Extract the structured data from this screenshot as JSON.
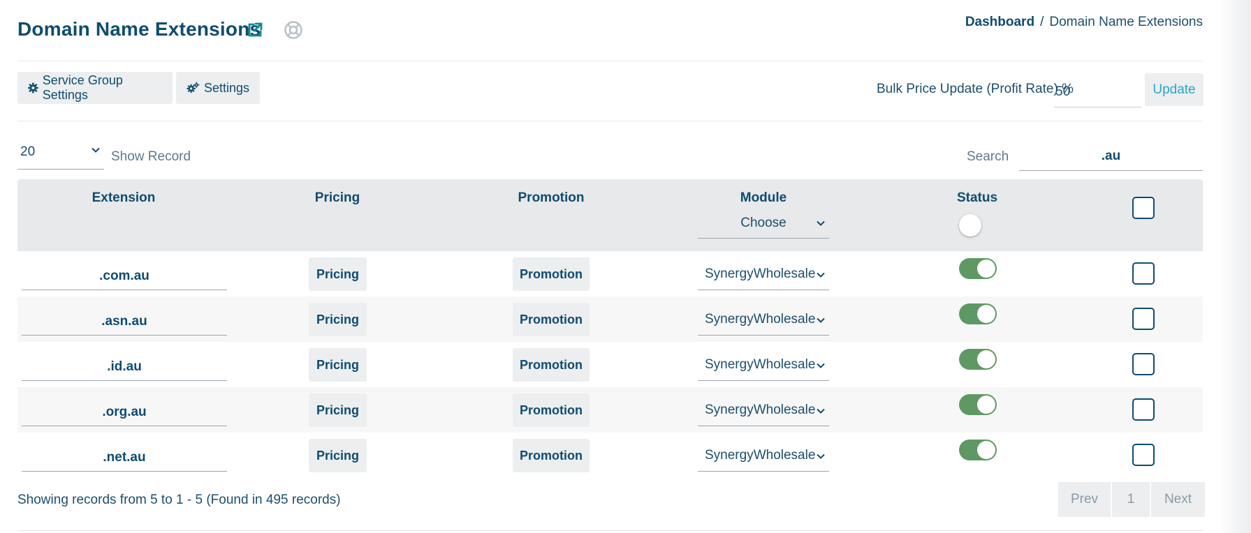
{
  "header": {
    "title": "Domain Name Extensions",
    "external_link_icon": "external-link-icon",
    "help_icon": "life-ring-icon"
  },
  "breadcrumb": {
    "home": "Dashboard",
    "separator": "/",
    "current": "Domain Name Extensions"
  },
  "toolbar": {
    "service_group_settings": "Service Group Settings",
    "service_group_icon": "gear-icon",
    "settings": "Settings",
    "settings_icon": "gears-icon",
    "bulk_label": "Bulk Price Update (Profit Rate) %",
    "bulk_value": "50",
    "update": "Update"
  },
  "list_controls": {
    "records_per_page": "20",
    "show_record": "Show Record",
    "search_label": "Search",
    "search_value": ".au"
  },
  "table": {
    "columns": [
      "Extension",
      "Pricing",
      "Promotion",
      "Module",
      "Status"
    ],
    "module_filter": "Choose",
    "status_filter_on": false,
    "rows": [
      {
        "extension": ".com.au",
        "pricing": "Pricing",
        "promotion": "Promotion",
        "module": "SynergyWholesale",
        "status_on": true,
        "checked": false
      },
      {
        "extension": ".asn.au",
        "pricing": "Pricing",
        "promotion": "Promotion",
        "module": "SynergyWholesale",
        "status_on": true,
        "checked": false
      },
      {
        "extension": ".id.au",
        "pricing": "Pricing",
        "promotion": "Promotion",
        "module": "SynergyWholesale",
        "status_on": true,
        "checked": false
      },
      {
        "extension": ".org.au",
        "pricing": "Pricing",
        "promotion": "Promotion",
        "module": "SynergyWholesale",
        "status_on": true,
        "checked": false
      },
      {
        "extension": ".net.au",
        "pricing": "Pricing",
        "promotion": "Promotion",
        "module": "SynergyWholesale",
        "status_on": true,
        "checked": false
      }
    ]
  },
  "footer": {
    "summary": "Showing records from 5 to 1 - 5 (Found in 495 records)",
    "prev": "Prev",
    "page": "1",
    "next": "Next"
  },
  "colors": {
    "primary_text": "#0f4c70",
    "accent_update": "#27a7c6",
    "toggle_on": "#5e9963",
    "button_bg": "#eceeef",
    "table_header_bg": "#e8e9ea"
  }
}
